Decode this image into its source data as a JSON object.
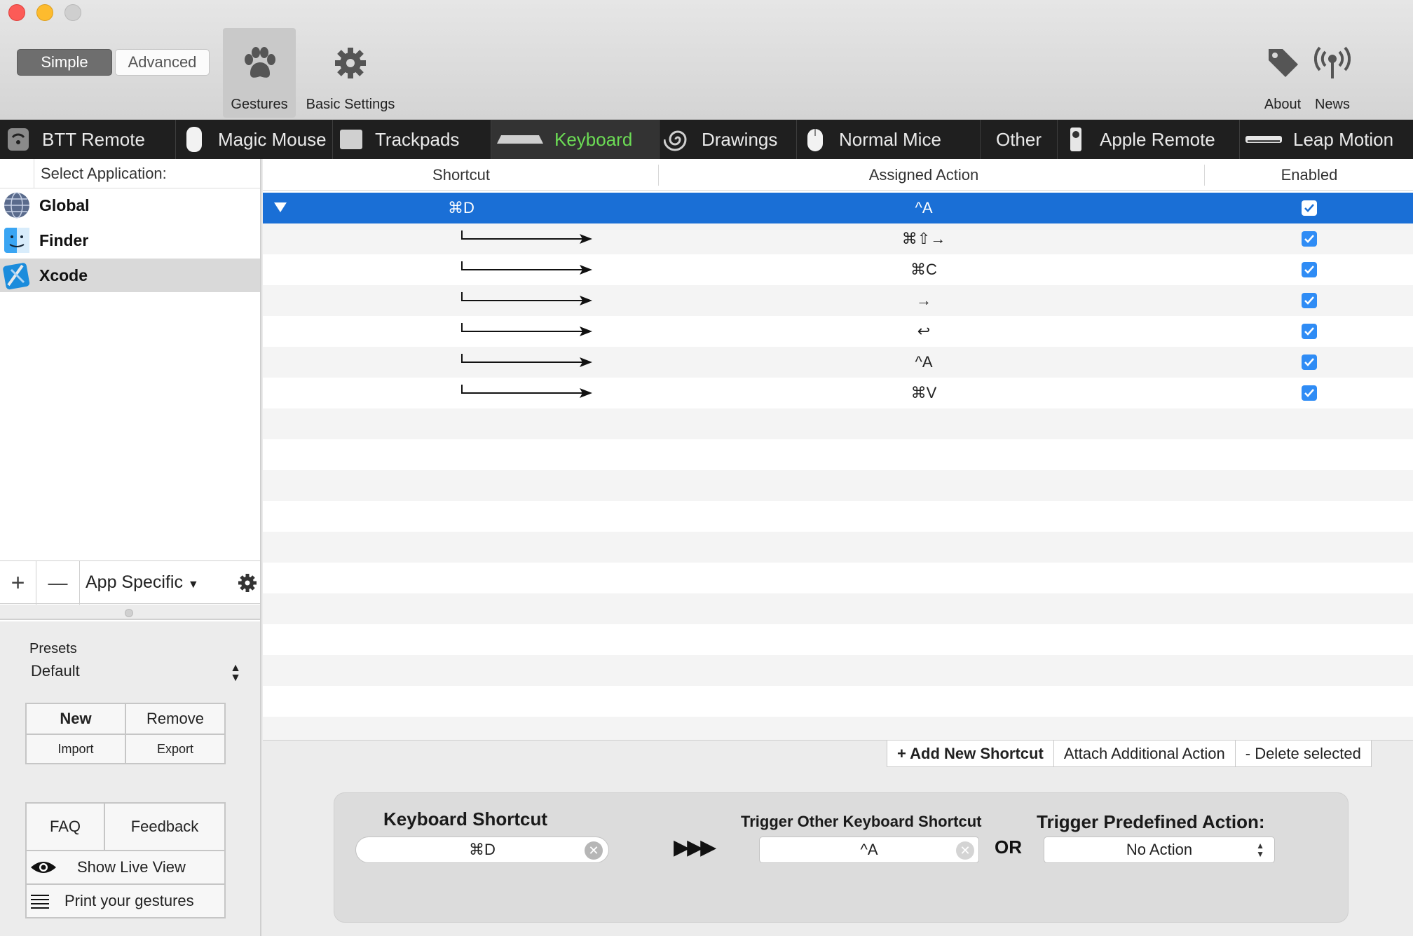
{
  "window": {
    "mode_simple": "Simple",
    "mode_advanced": "Advanced"
  },
  "toolbar": {
    "gestures": "Gestures",
    "basic_settings": "Basic Settings",
    "about": "About",
    "news": "News"
  },
  "tabs": [
    {
      "label": "BTT Remote",
      "icon": "remote-icon"
    },
    {
      "label": "Magic Mouse",
      "icon": "magic-mouse-icon"
    },
    {
      "label": "Trackpads",
      "icon": "trackpad-icon"
    },
    {
      "label": "Keyboard",
      "icon": "keyboard-icon",
      "active": true
    },
    {
      "label": "Drawings",
      "icon": "spiral-icon"
    },
    {
      "label": "Normal Mice",
      "icon": "mouse-icon"
    },
    {
      "label": "Other",
      "icon": ""
    },
    {
      "label": "Apple Remote",
      "icon": "apple-remote-icon"
    },
    {
      "label": "Leap Motion",
      "icon": "leap-motion-icon"
    }
  ],
  "sidebar": {
    "header": "Select Application:",
    "apps": [
      {
        "name": "Global",
        "icon": "globe-icon"
      },
      {
        "name": "Finder",
        "icon": "finder-icon"
      },
      {
        "name": "Xcode",
        "icon": "xcode-icon",
        "selected": true
      }
    ],
    "add": "+",
    "remove": "—",
    "filter": "App Specific",
    "presets_label": "Presets",
    "preset_value": "Default",
    "buttons": {
      "new": "New",
      "remove": "Remove",
      "import": "Import",
      "export": "Export",
      "faq": "FAQ",
      "feedback": "Feedback",
      "show_live_view": "Show Live View",
      "print_gestures": "Print your gestures"
    }
  },
  "table": {
    "columns": {
      "shortcut": "Shortcut",
      "action": "Assigned Action",
      "enabled": "Enabled"
    },
    "rows": [
      {
        "shortcut": "⌘D",
        "action": "^A",
        "enabled": true,
        "selected": true,
        "child": false
      },
      {
        "shortcut": "",
        "action": "⌘⇧→",
        "enabled": true,
        "child": true
      },
      {
        "shortcut": "",
        "action": "⌘C",
        "enabled": true,
        "child": true
      },
      {
        "shortcut": "",
        "action": "→",
        "enabled": true,
        "child": true
      },
      {
        "shortcut": "",
        "action": "↩",
        "enabled": true,
        "child": true
      },
      {
        "shortcut": "",
        "action": "^A",
        "enabled": true,
        "child": true
      },
      {
        "shortcut": "",
        "action": "⌘V",
        "enabled": true,
        "child": true
      }
    ]
  },
  "actions": {
    "add": "+ Add New Shortcut",
    "attach": "Attach Additional Action",
    "delete": "- Delete selected"
  },
  "config": {
    "keyboard_shortcut_title": "Keyboard Shortcut",
    "keyboard_shortcut_value": "⌘D",
    "arrows": "▶▶▶",
    "trigger_other_title": "Trigger Other Keyboard Shortcut",
    "trigger_other_value": "^A",
    "or": "OR",
    "predefined_title": "Trigger Predefined Action:",
    "predefined_value": "No Action"
  },
  "colors": {
    "selection": "#1a6fd6",
    "active_tab_text": "#6cdc55",
    "checkbox": "#2f8cf5"
  }
}
